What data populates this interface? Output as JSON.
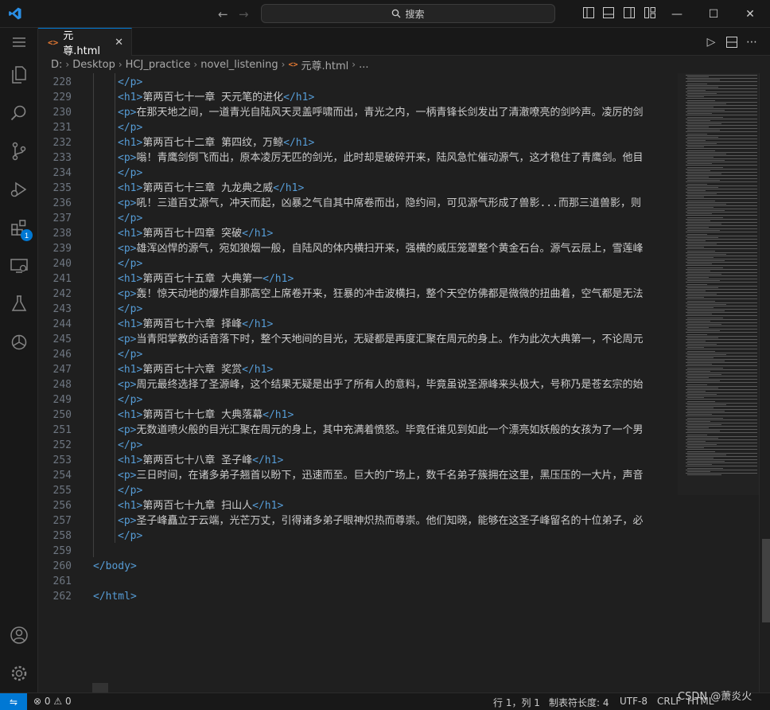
{
  "titlebar": {
    "search_label": "搜索",
    "back_icon": "arrow-left-icon",
    "forward_icon": "arrow-right-icon"
  },
  "tab": {
    "file_name": "元尊.html",
    "file_icon_text": "<>"
  },
  "breadcrumb": [
    "D:",
    "Desktop",
    "HCJ_practice",
    "novel_listening",
    "元尊.html",
    "..."
  ],
  "activity": {
    "extensions_badge": "1"
  },
  "editor": {
    "lines": [
      {
        "n": "228",
        "indent": 2,
        "parts": [
          {
            "t": "</p>",
            "k": "tag"
          }
        ]
      },
      {
        "n": "229",
        "indent": 2,
        "parts": [
          {
            "t": "<h1>",
            "k": "tag"
          },
          {
            "t": "第两百七十一章 天元笔的进化",
            "k": "txt"
          },
          {
            "t": "</h1>",
            "k": "tag"
          }
        ]
      },
      {
        "n": "230",
        "indent": 2,
        "parts": [
          {
            "t": "<p>",
            "k": "tag"
          },
          {
            "t": "在那天地之间，一道青光自陆风天灵盖呼啸而出，青光之内，一柄青锋长剑发出了清澈嘹亮的剑吟声。凌厉的剑",
            "k": "txt"
          }
        ]
      },
      {
        "n": "231",
        "indent": 2,
        "parts": [
          {
            "t": "</p>",
            "k": "tag"
          }
        ]
      },
      {
        "n": "232",
        "indent": 2,
        "parts": [
          {
            "t": "<h1>",
            "k": "tag"
          },
          {
            "t": "第两百七十二章 第四纹，万鲸",
            "k": "txt"
          },
          {
            "t": "</h1>",
            "k": "tag"
          }
        ]
      },
      {
        "n": "233",
        "indent": 2,
        "parts": [
          {
            "t": "<p>",
            "k": "tag"
          },
          {
            "t": "嗡！青鹰剑倒飞而出，原本凌厉无匹的剑光，此时却是破碎开来，陆风急忙催动源气，这才稳住了青鹰剑。他目",
            "k": "txt"
          }
        ]
      },
      {
        "n": "234",
        "indent": 2,
        "parts": [
          {
            "t": "</p>",
            "k": "tag"
          }
        ]
      },
      {
        "n": "235",
        "indent": 2,
        "parts": [
          {
            "t": "<h1>",
            "k": "tag"
          },
          {
            "t": "第两百七十三章 九龙典之威",
            "k": "txt"
          },
          {
            "t": "</h1>",
            "k": "tag"
          }
        ]
      },
      {
        "n": "236",
        "indent": 2,
        "parts": [
          {
            "t": "<p>",
            "k": "tag"
          },
          {
            "t": "吼！三道百丈源气，冲天而起，凶暴之气自其中席卷而出，隐约间，可见源气形成了兽影...而那三道兽影，则",
            "k": "txt"
          }
        ]
      },
      {
        "n": "237",
        "indent": 2,
        "parts": [
          {
            "t": "</p>",
            "k": "tag"
          }
        ]
      },
      {
        "n": "238",
        "indent": 2,
        "parts": [
          {
            "t": "<h1>",
            "k": "tag"
          },
          {
            "t": "第两百七十四章 突破",
            "k": "txt"
          },
          {
            "t": "</h1>",
            "k": "tag"
          }
        ]
      },
      {
        "n": "239",
        "indent": 2,
        "parts": [
          {
            "t": "<p>",
            "k": "tag"
          },
          {
            "t": "雄浑凶悍的源气，宛如狼烟一般，自陆风的体内横扫开来，强横的威压笼罩整个黄金石台。源气云层上，雪莲峰",
            "k": "txt"
          }
        ]
      },
      {
        "n": "240",
        "indent": 2,
        "parts": [
          {
            "t": "</p>",
            "k": "tag"
          }
        ]
      },
      {
        "n": "241",
        "indent": 2,
        "parts": [
          {
            "t": "<h1>",
            "k": "tag"
          },
          {
            "t": "第两百七十五章 大典第一",
            "k": "txt"
          },
          {
            "t": "</h1>",
            "k": "tag"
          }
        ]
      },
      {
        "n": "242",
        "indent": 2,
        "parts": [
          {
            "t": "<p>",
            "k": "tag"
          },
          {
            "t": "轰！惊天动地的爆炸自那高空上席卷开来，狂暴的冲击波横扫，整个天空仿佛都是微微的扭曲着，空气都是无法",
            "k": "txt"
          }
        ]
      },
      {
        "n": "243",
        "indent": 2,
        "parts": [
          {
            "t": "</p>",
            "k": "tag"
          }
        ]
      },
      {
        "n": "244",
        "indent": 2,
        "parts": [
          {
            "t": "<h1>",
            "k": "tag"
          },
          {
            "t": "第两百七十六章 择峰",
            "k": "txt"
          },
          {
            "t": "</h1>",
            "k": "tag"
          }
        ]
      },
      {
        "n": "245",
        "indent": 2,
        "parts": [
          {
            "t": "<p>",
            "k": "tag"
          },
          {
            "t": "当青阳掌教的话音落下时，整个天地间的目光，无疑都是再度汇聚在周元的身上。作为此次大典第一，不论周元",
            "k": "txt"
          }
        ]
      },
      {
        "n": "246",
        "indent": 2,
        "parts": [
          {
            "t": "</p>",
            "k": "tag"
          }
        ]
      },
      {
        "n": "247",
        "indent": 2,
        "parts": [
          {
            "t": "<h1>",
            "k": "tag"
          },
          {
            "t": "第两百七十六章 奖赏",
            "k": "txt"
          },
          {
            "t": "</h1>",
            "k": "tag"
          }
        ]
      },
      {
        "n": "248",
        "indent": 2,
        "parts": [
          {
            "t": "<p>",
            "k": "tag"
          },
          {
            "t": "周元最终选择了圣源峰，这个结果无疑是出乎了所有人的意料，毕竟虽说圣源峰来头极大，号称乃是苍玄宗的始",
            "k": "txt"
          }
        ]
      },
      {
        "n": "249",
        "indent": 2,
        "parts": [
          {
            "t": "</p>",
            "k": "tag"
          }
        ]
      },
      {
        "n": "250",
        "indent": 2,
        "parts": [
          {
            "t": "<h1>",
            "k": "tag"
          },
          {
            "t": "第两百七十七章 大典落幕",
            "k": "txt"
          },
          {
            "t": "</h1>",
            "k": "tag"
          }
        ]
      },
      {
        "n": "251",
        "indent": 2,
        "parts": [
          {
            "t": "<p>",
            "k": "tag"
          },
          {
            "t": "无数道喷火般的目光汇聚在周元的身上，其中充满着愤怒。毕竟任谁见到如此一个漂亮如妖般的女孩为了一个男",
            "k": "txt"
          }
        ]
      },
      {
        "n": "252",
        "indent": 2,
        "parts": [
          {
            "t": "</p>",
            "k": "tag"
          }
        ]
      },
      {
        "n": "253",
        "indent": 2,
        "parts": [
          {
            "t": "<h1>",
            "k": "tag"
          },
          {
            "t": "第两百七十八章 圣子峰",
            "k": "txt"
          },
          {
            "t": "</h1>",
            "k": "tag"
          }
        ]
      },
      {
        "n": "254",
        "indent": 2,
        "parts": [
          {
            "t": "<p>",
            "k": "tag"
          },
          {
            "t": "三日时间，在诸多弟子翘首以盼下，迅速而至。巨大的广场上，数千名弟子簇拥在这里，黑压压的一大片，声音",
            "k": "txt"
          }
        ]
      },
      {
        "n": "255",
        "indent": 2,
        "parts": [
          {
            "t": "</p>",
            "k": "tag"
          }
        ]
      },
      {
        "n": "256",
        "indent": 2,
        "parts": [
          {
            "t": "<h1>",
            "k": "tag"
          },
          {
            "t": "第两百七十九章 扫山人",
            "k": "txt"
          },
          {
            "t": "</h1>",
            "k": "tag"
          }
        ]
      },
      {
        "n": "257",
        "indent": 2,
        "parts": [
          {
            "t": "<p>",
            "k": "tag"
          },
          {
            "t": "圣子峰矗立于云端，光芒万丈，引得诸多弟子眼神炽热而尊崇。他们知晓，能够在这圣子峰留名的十位弟子，必",
            "k": "txt"
          }
        ]
      },
      {
        "n": "258",
        "indent": 2,
        "parts": [
          {
            "t": "</p>",
            "k": "tag"
          }
        ]
      },
      {
        "n": "259",
        "indent": 0,
        "parts": []
      },
      {
        "n": "260",
        "indent": 0,
        "parts": [
          {
            "t": "</body>",
            "k": "tag"
          }
        ]
      },
      {
        "n": "261",
        "indent": 0,
        "parts": []
      },
      {
        "n": "262",
        "indent": 0,
        "parts": [
          {
            "t": "</html>",
            "k": "tag"
          }
        ]
      }
    ]
  },
  "statusbar": {
    "errors": "0",
    "warnings": "0",
    "position": "行 1，列 1",
    "tab_size": "制表符长度: 4",
    "encoding": "UTF-8",
    "eol": "CRLF",
    "language": "HTML"
  },
  "watermark": "CSDN @萧炎火",
  "colors": {
    "accent": "#0078d4",
    "tag": "#569cd6",
    "text": "#cccccc",
    "background": "#1f1f1f"
  }
}
